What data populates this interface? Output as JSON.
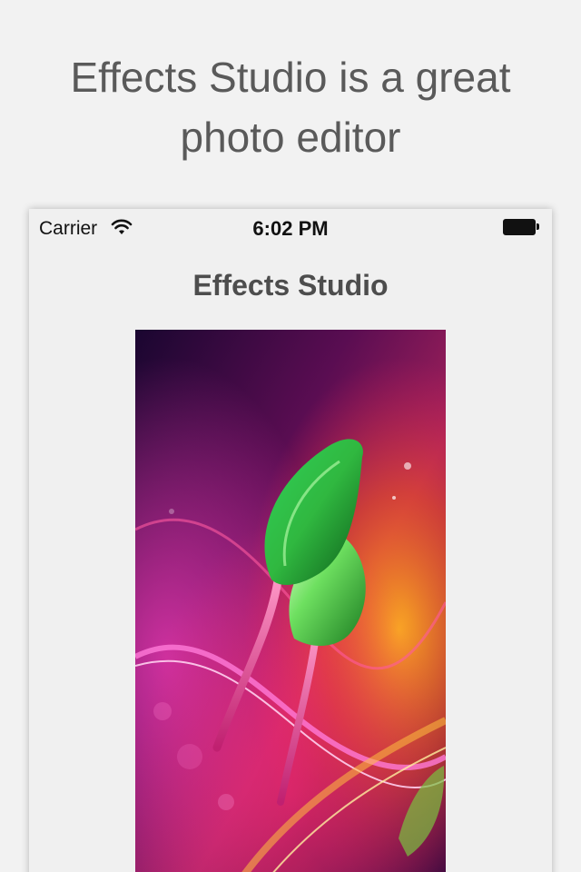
{
  "headline": {
    "line1": "Effects Studio is a great",
    "line2": "photo editor"
  },
  "status_bar": {
    "carrier": "Carrier",
    "time": "6:02 PM",
    "wifi_icon": "wifi-icon",
    "battery_icon": "battery-icon"
  },
  "nav": {
    "title": "Effects Studio"
  },
  "photo": {
    "subject": "glowing-green-flower-bud-image"
  }
}
